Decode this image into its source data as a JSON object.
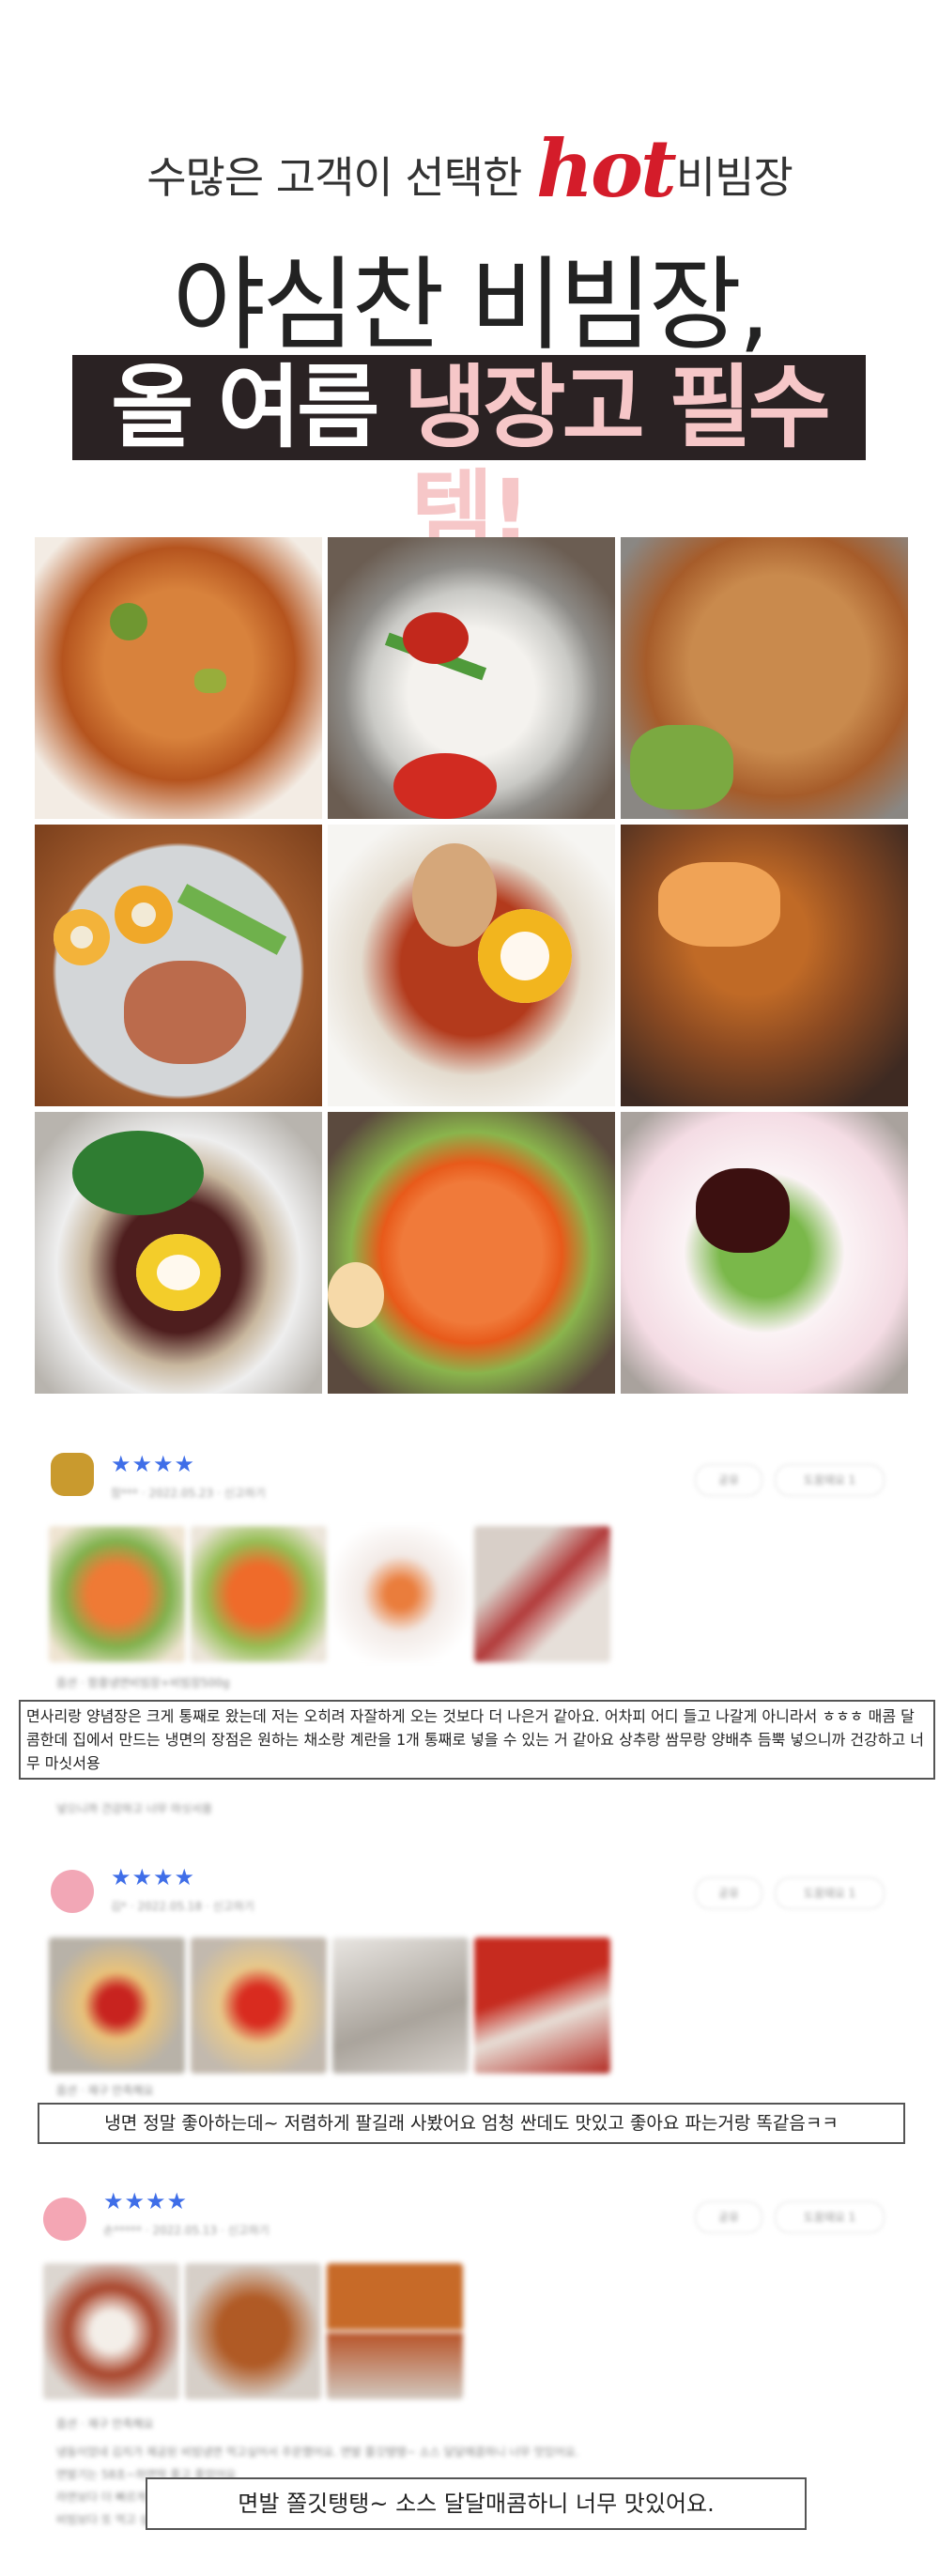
{
  "hero": {
    "subtitle_before": "수많은 고객이 선택한",
    "subtitle_hot": "hot",
    "subtitle_after": "비빔장",
    "title": "야심찬 비빔장,",
    "banner_before": "올 여름",
    "banner_pink": "냉장고 필수템!"
  },
  "colors": {
    "hot": "#d41c2a",
    "banner_bg": "#2a2223",
    "banner_pink": "#f6c7c8",
    "stars": "#3f6ee8"
  },
  "reviews": [
    {
      "stars": "★★★★",
      "meta": "참*** · 2022.05.23 · 신고하기",
      "share_label": "공유",
      "helpful_label": "도움돼요 1",
      "option": "옵션 · 함흥냉면비빔장+비빔장500g",
      "caption": "면사리랑 양념장은 크게 통째로 왔는데 저는 오히려 자잘하게 오는 것보다 더 나은거 같아요. 어차피 어디 들고 나갈게 아니라서 ㅎㅎㅎ 매콤 달콤한데 집에서 만드는 냉면의 장점은 원하는 채소랑 계란을 1개 통째로 넣을 수 있는 거 같아요 상추랑 쌈무랑 양배추 듬뿍 넣으니까 건강하고 너무 마싯서용",
      "extra": "넣으니까 건강하고 너무 마싯서용"
    },
    {
      "stars": "★★★★",
      "meta": "김* · 2022.05.18 · 신고하기",
      "share_label": "공유",
      "helpful_label": "도움돼요 1",
      "option": "옵션 · 재구 만족해요",
      "caption": "냉면 정말 좋아하는데~ 저렴하게 팔길래 사봤어요 엄청 싼데도 맛있고 좋아요 파는거랑 똑같음ㅋㅋ"
    },
    {
      "stars": "★★★★",
      "meta": "손***** · 2022.05.13 · 신고하기",
      "share_label": "공유",
      "helpful_label": "도움돼요 1",
      "option": "옵션 · 재구 만족해요",
      "caption": "면발 쫄깃탱탱~ 소스 달달매콤하니 너무 맛있어요.",
      "blur_lines": [
        "냉동이었네 김치가 제공된 비빔냉면 먹고싶어서 주문했어요. 면발 쫄깃탱탱~ 소스 달달매콤하니 너무 맛있어요.",
        "면발기는 58초~하면딱 좋고 좋았어요",
        "라면보다 더 빠르게 만들 수 있어서 좋아요",
        "비빔보다 또 먹고 싶어서 재주문"
      ]
    }
  ]
}
